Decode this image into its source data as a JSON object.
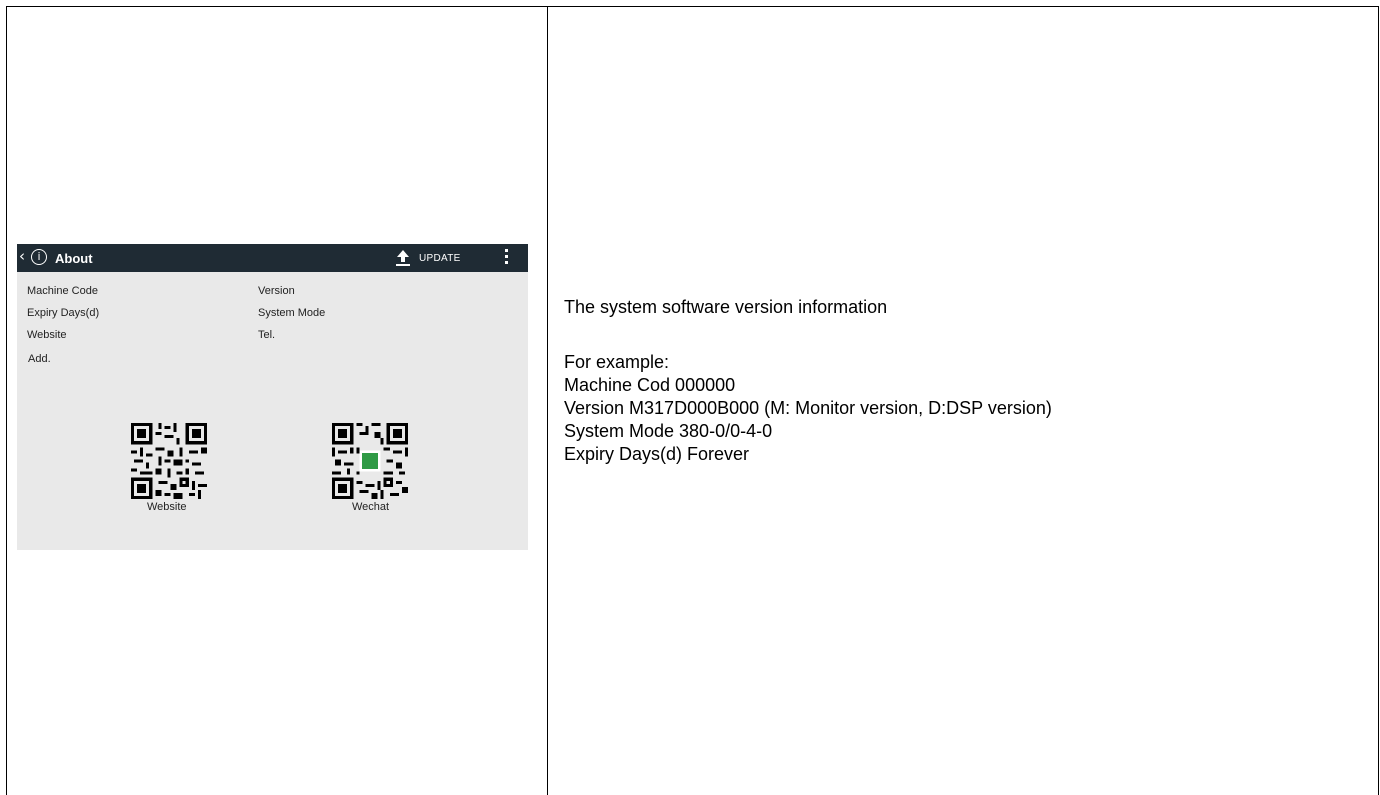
{
  "device": {
    "title": "About",
    "update_label": "UPDATE",
    "fields": {
      "machine_code": "Machine Code",
      "expiry_days": "Expiry Days(d)",
      "website": "Website",
      "address": "Add.",
      "version": "Version",
      "system_mode": "System Mode",
      "tel": "Tel."
    },
    "qr_captions": {
      "website": "Website",
      "wechat": "Wechat"
    },
    "icons": {
      "back": "chevron-left-icon",
      "info": "info-icon",
      "update": "upload-icon",
      "menu": "more-vertical-icon"
    },
    "colors": {
      "topbar": "#1f2b34",
      "panel": "#e9e9e9",
      "wechat_logo": "#2f9a45"
    }
  },
  "description": {
    "heading": "The system software version information",
    "example_label": "For example:",
    "lines": [
      "Machine Cod 000000",
      "Version M317D000B000 (M: Monitor version, D:DSP version)",
      "System Mode 380-0/0-4-0",
      "Expiry Days(d) Forever"
    ]
  }
}
